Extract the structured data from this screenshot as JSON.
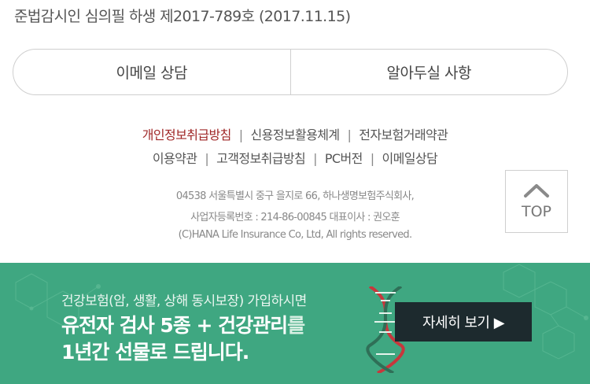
{
  "notice": "준법감시인 심의필 하생 제2017-789호 (2017.11.15)",
  "buttons": {
    "email": "이메일 상담",
    "notice": "알아두실 사항"
  },
  "links_row1": [
    "개인정보취급방침",
    "신용정보활용체계",
    "전자보험거래약관"
  ],
  "links_row2": [
    "이용약관",
    "고객정보취급방침",
    "PC버전",
    "이메일상담"
  ],
  "separator": "|",
  "company": {
    "address": "04538 서울특별시 중구 을지로 66, 하나생명보험주식회사,",
    "registration": "사업자등록번호 : 214-86-00845 대표이사 : 권오훈",
    "copyright": "(C)HANA Life Insurance Co, Ltd, All rights reserved."
  },
  "top_button": "TOP",
  "banner": {
    "line1": "건강보험(암, 생활, 상해 동시보장) 가입하시면",
    "line2_main": "유전자 검사 5종 + 건강관리",
    "line2_suffix": "를",
    "line3": "1년간 선물로 드립니다.",
    "detail_button": "자세히 보기 ▶"
  },
  "colors": {
    "banner_bg": "#3fa781",
    "active_link": "#a02828",
    "detail_button_bg": "#1d2a2e"
  },
  "icons": [
    "chevron-up-icon",
    "dna-icon"
  ]
}
